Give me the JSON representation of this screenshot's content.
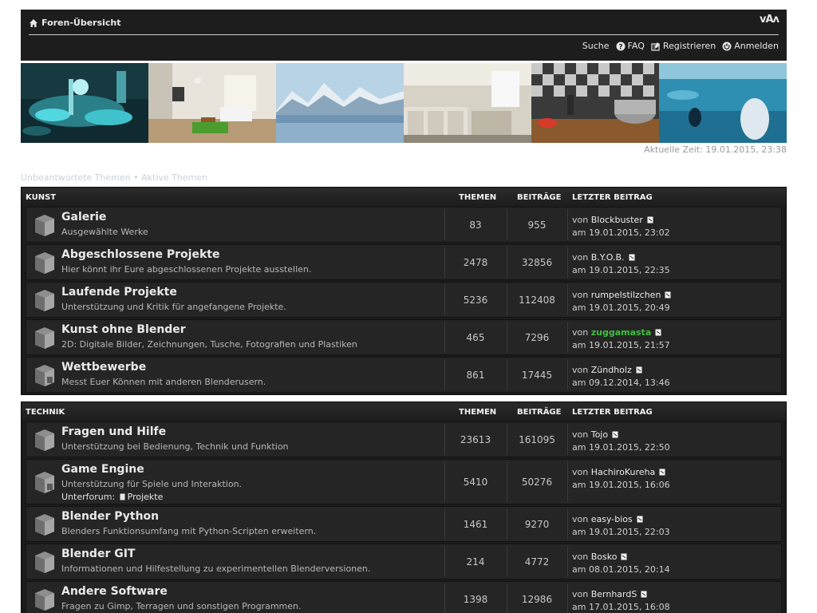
{
  "header": {
    "home_label": "Foren-Übersicht",
    "font_toggle": "vAʌ",
    "nav": {
      "search": "Suche",
      "faq": "FAQ",
      "register": "Registrieren",
      "login": "Anmelden"
    }
  },
  "current_time": "Aktuelle Zeit: 19.01.2015, 23:38",
  "quicklinks": {
    "unanswered": "Unbeantwortete Themen",
    "separator": "•",
    "active": "Aktive Themen"
  },
  "categories": [
    {
      "name": "KUNST",
      "col_topics": "THEMEN",
      "col_posts": "BEITRÄGE",
      "col_last": "LETZTER BEITRAG",
      "forums": [
        {
          "title": "Galerie",
          "desc": "Ausgewählte Werke",
          "topics": "83",
          "posts": "955",
          "by": "von",
          "user": "Blockbuster",
          "date": "am 19.01.2015, 23:02"
        },
        {
          "title": "Abgeschlossene Projekte",
          "desc": "Hier könnt ihr Eure abgeschlossenen Projekte ausstellen.",
          "topics": "2478",
          "posts": "32856",
          "by": "von",
          "user": "B.Y.O.B.",
          "date": "am 19.01.2015, 22:35"
        },
        {
          "title": "Laufende Projekte",
          "desc": "Unterstützung und Kritik für angefangene Projekte.",
          "topics": "5236",
          "posts": "112408",
          "by": "von",
          "user": "rumpelstilzchen",
          "date": "am 19.01.2015, 20:49"
        },
        {
          "title": "Kunst ohne Blender",
          "desc": "2D: Digitale Bilder, Zeichnungen, Tusche, Fotografien und Plastiken",
          "topics": "465",
          "posts": "7296",
          "by": "von",
          "user": "zuggamasta",
          "date": "am 19.01.2015, 21:57"
        },
        {
          "title": "Wettbewerbe",
          "desc": "Messt Euer Können mit anderen Blenderusern.",
          "topics": "861",
          "posts": "17445",
          "by": "von",
          "user": "Zündholz",
          "date": "am 09.12.2014, 13:46"
        }
      ]
    },
    {
      "name": "TECHNIK",
      "col_topics": "THEMEN",
      "col_posts": "BEITRÄGE",
      "col_last": "LETZTER BEITRAG",
      "forums": [
        {
          "title": "Fragen und Hilfe",
          "desc": "Unterstützung bei Bedienung, Technik und Funktion",
          "topics": "23613",
          "posts": "161095",
          "by": "von",
          "user": "Tojo",
          "date": "am 19.01.2015, 22:50"
        },
        {
          "title": "Game Engine",
          "desc": "Unterstützung für Spiele und Interaktion.",
          "sub_label": "Unterforum:",
          "sub_link": "Projekte",
          "topics": "5410",
          "posts": "50276",
          "by": "von",
          "user": "HachiroKureha",
          "date": "am 19.01.2015, 16:06"
        },
        {
          "title": "Blender Python",
          "desc": "Blenders Funktionsumfang mit Python-Scripten erweitern.",
          "topics": "1461",
          "posts": "9270",
          "by": "von",
          "user": "easy-bios",
          "date": "am 19.01.2015, 22:03"
        },
        {
          "title": "Blender GIT",
          "desc": "Informationen und Hilfestellung zu experimentellen Blenderversionen.",
          "topics": "214",
          "posts": "4772",
          "by": "von",
          "user": "Bosko",
          "date": "am 08.01.2015, 20:14"
        },
        {
          "title": "Andere Software",
          "desc": "Fragen zu Gimp, Terragen und sonstigen Programmen.",
          "topics": "1398",
          "posts": "12986",
          "by": "von",
          "user": "BernhardS",
          "date": "am 17.01.2015, 16:08"
        }
      ]
    }
  ],
  "colors": {
    "header_bg": "#1d1d1d",
    "row_bg": "#252525",
    "highlight_user": "#3fbf3f"
  }
}
